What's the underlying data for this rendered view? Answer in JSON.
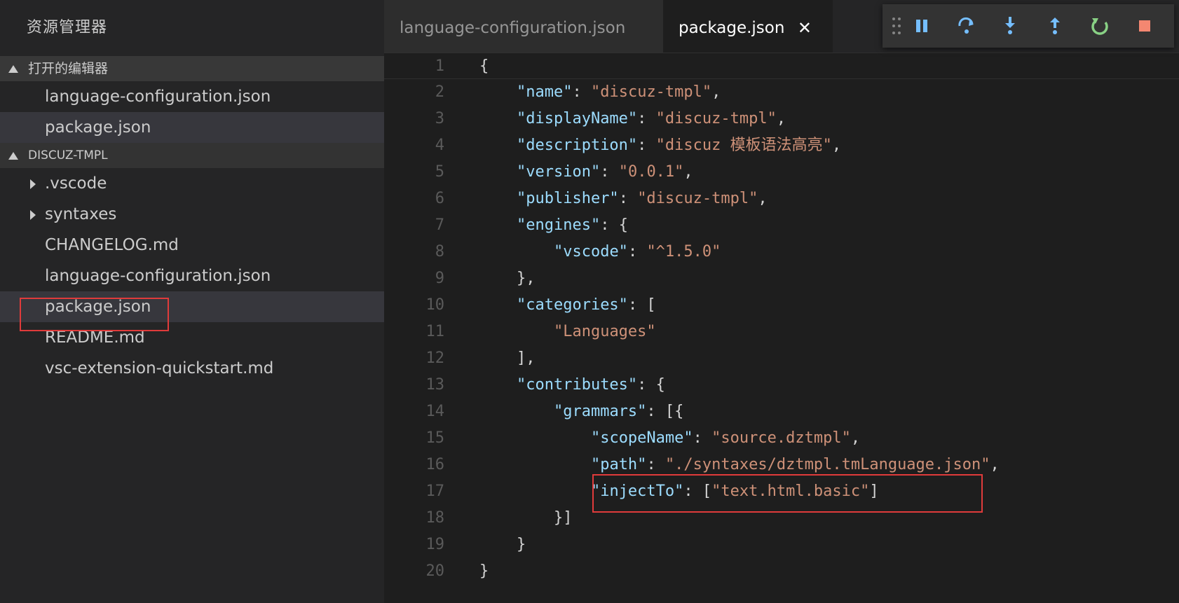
{
  "sidebar": {
    "title": "资源管理器",
    "open_editors": {
      "label": "打开的编辑器",
      "items": [
        "language-configuration.json",
        "package.json"
      ]
    },
    "folder": {
      "label": "DISCUZ-TMPL",
      "items": [
        ".vscode",
        "syntaxes",
        "CHANGELOG.md",
        "language-configuration.json",
        "package.json",
        "README.md",
        "vsc-extension-quickstart.md"
      ]
    }
  },
  "tabs": [
    {
      "label": "language-configuration.json"
    },
    {
      "label": "package.json",
      "close": "✕"
    }
  ],
  "debug": {
    "icons": [
      "drag-handle-icon",
      "pause-icon",
      "step-over-icon",
      "step-into-icon",
      "step-out-icon",
      "restart-icon",
      "stop-icon"
    ]
  },
  "colors": {
    "highlight": "#e03b3b",
    "key": "#9cdcfe",
    "string": "#ce9178",
    "restart": "#89d185",
    "stop": "#f48771",
    "pause": "#75beff"
  },
  "code": {
    "lines": [
      "{",
      "    \"name\": \"discuz-tmpl\",",
      "    \"displayName\": \"discuz-tmpl\",",
      "    \"description\": \"discuz 模板语法高亮\",",
      "    \"version\": \"0.0.1\",",
      "    \"publisher\": \"discuz-tmpl\",",
      "    \"engines\": {",
      "        \"vscode\": \"^1.5.0\"",
      "    },",
      "    \"categories\": [",
      "        \"Languages\"",
      "    ],",
      "    \"contributes\": {",
      "        \"grammars\": [{",
      "            \"scopeName\": \"source.dztmpl\",",
      "            \"path\": \"./syntaxes/dztmpl.tmLanguage.json\",",
      "            \"injectTo\": [\"text.html.basic\"]",
      "        }]",
      "    }",
      "}"
    ],
    "line_numbers": [
      "1",
      "2",
      "3",
      "4",
      "5",
      "6",
      "7",
      "8",
      "9",
      "10",
      "11",
      "12",
      "13",
      "14",
      "15",
      "16",
      "17",
      "18",
      "19",
      "20"
    ]
  }
}
